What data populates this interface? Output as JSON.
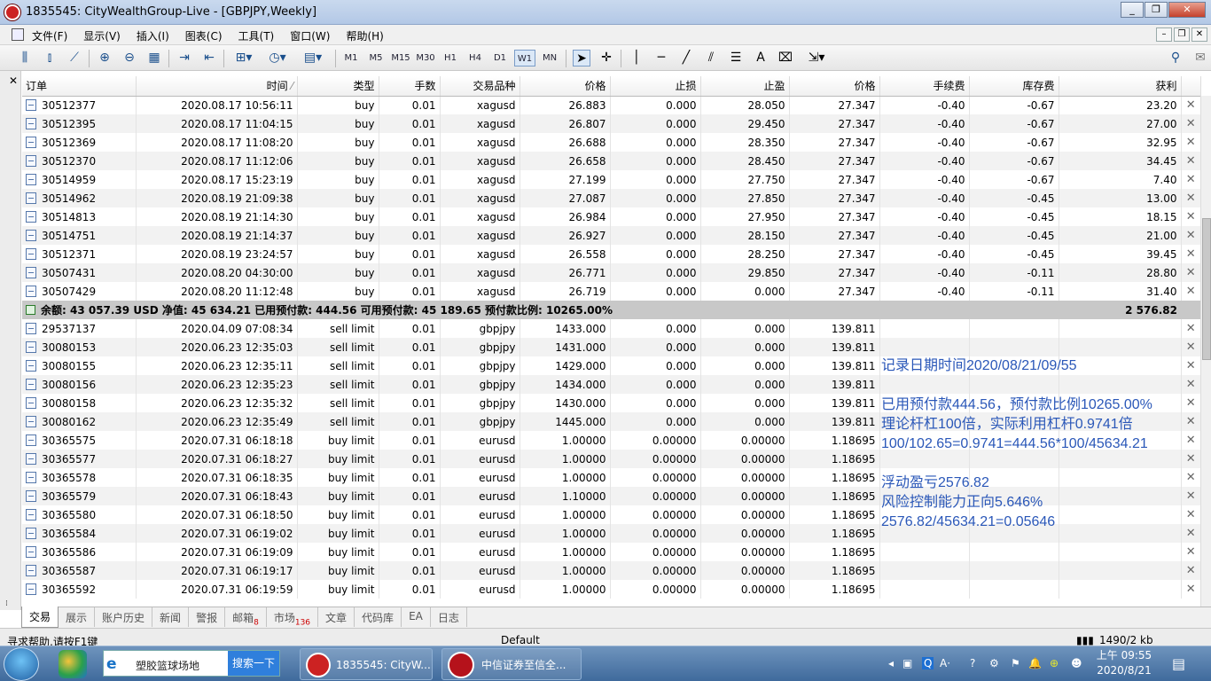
{
  "window": {
    "title": "1835545: CityWealthGroup-Live - [GBPJPY,Weekly]"
  },
  "menu": [
    "文件(F)",
    "显示(V)",
    "插入(I)",
    "图表(C)",
    "工具(T)",
    "窗口(W)",
    "帮助(H)"
  ],
  "toolbar": {
    "timeframes": [
      "M1",
      "M5",
      "M15",
      "M30",
      "H1",
      "H4",
      "D1",
      "W1",
      "MN"
    ],
    "active_timeframe": "W1",
    "text_tool": "A"
  },
  "columns": [
    "订单",
    "时间",
    "类型",
    "手数",
    "交易品种",
    "价格",
    "止损",
    "止盈",
    "价格",
    "手续费",
    "库存费",
    "获利"
  ],
  "open_orders": [
    [
      "30512377",
      "2020.08.17 10:56:11",
      "buy",
      "0.01",
      "xagusd",
      "26.883",
      "0.000",
      "28.050",
      "27.347",
      "-0.40",
      "-0.67",
      "23.20"
    ],
    [
      "30512395",
      "2020.08.17 11:04:15",
      "buy",
      "0.01",
      "xagusd",
      "26.807",
      "0.000",
      "29.450",
      "27.347",
      "-0.40",
      "-0.67",
      "27.00"
    ],
    [
      "30512369",
      "2020.08.17 11:08:20",
      "buy",
      "0.01",
      "xagusd",
      "26.688",
      "0.000",
      "28.350",
      "27.347",
      "-0.40",
      "-0.67",
      "32.95"
    ],
    [
      "30512370",
      "2020.08.17 11:12:06",
      "buy",
      "0.01",
      "xagusd",
      "26.658",
      "0.000",
      "28.450",
      "27.347",
      "-0.40",
      "-0.67",
      "34.45"
    ],
    [
      "30514959",
      "2020.08.17 15:23:19",
      "buy",
      "0.01",
      "xagusd",
      "27.199",
      "0.000",
      "27.750",
      "27.347",
      "-0.40",
      "-0.67",
      "7.40"
    ],
    [
      "30514962",
      "2020.08.19 21:09:38",
      "buy",
      "0.01",
      "xagusd",
      "27.087",
      "0.000",
      "27.850",
      "27.347",
      "-0.40",
      "-0.45",
      "13.00"
    ],
    [
      "30514813",
      "2020.08.19 21:14:30",
      "buy",
      "0.01",
      "xagusd",
      "26.984",
      "0.000",
      "27.950",
      "27.347",
      "-0.40",
      "-0.45",
      "18.15"
    ],
    [
      "30514751",
      "2020.08.19 21:14:37",
      "buy",
      "0.01",
      "xagusd",
      "26.927",
      "0.000",
      "28.150",
      "27.347",
      "-0.40",
      "-0.45",
      "21.00"
    ],
    [
      "30512371",
      "2020.08.19 23:24:57",
      "buy",
      "0.01",
      "xagusd",
      "26.558",
      "0.000",
      "28.250",
      "27.347",
      "-0.40",
      "-0.45",
      "39.45"
    ],
    [
      "30507431",
      "2020.08.20 04:30:00",
      "buy",
      "0.01",
      "xagusd",
      "26.771",
      "0.000",
      "29.850",
      "27.347",
      "-0.40",
      "-0.11",
      "28.80"
    ],
    [
      "30507429",
      "2020.08.20 11:12:48",
      "buy",
      "0.01",
      "xagusd",
      "26.719",
      "0.000",
      "0.000",
      "27.347",
      "-0.40",
      "-0.11",
      "31.40"
    ]
  ],
  "summary": {
    "text": "余额: 43 057.39 USD  净值: 45 634.21  已用预付款: 444.56  可用预付款: 45 189.65  预付款比例: 10265.00%",
    "profit": "2 576.82"
  },
  "pending_orders": [
    [
      "29537137",
      "2020.04.09 07:08:34",
      "sell limit",
      "0.01",
      "gbpjpy",
      "1433.000",
      "0.000",
      "0.000",
      "139.811"
    ],
    [
      "30080153",
      "2020.06.23 12:35:03",
      "sell limit",
      "0.01",
      "gbpjpy",
      "1431.000",
      "0.000",
      "0.000",
      "139.811"
    ],
    [
      "30080155",
      "2020.06.23 12:35:11",
      "sell limit",
      "0.01",
      "gbpjpy",
      "1429.000",
      "0.000",
      "0.000",
      "139.811"
    ],
    [
      "30080156",
      "2020.06.23 12:35:23",
      "sell limit",
      "0.01",
      "gbpjpy",
      "1434.000",
      "0.000",
      "0.000",
      "139.811"
    ],
    [
      "30080158",
      "2020.06.23 12:35:32",
      "sell limit",
      "0.01",
      "gbpjpy",
      "1430.000",
      "0.000",
      "0.000",
      "139.811"
    ],
    [
      "30080162",
      "2020.06.23 12:35:49",
      "sell limit",
      "0.01",
      "gbpjpy",
      "1445.000",
      "0.000",
      "0.000",
      "139.811"
    ],
    [
      "30365575",
      "2020.07.31 06:18:18",
      "buy limit",
      "0.01",
      "eurusd",
      "1.00000",
      "0.00000",
      "0.00000",
      "1.18695"
    ],
    [
      "30365577",
      "2020.07.31 06:18:27",
      "buy limit",
      "0.01",
      "eurusd",
      "1.00000",
      "0.00000",
      "0.00000",
      "1.18695"
    ],
    [
      "30365578",
      "2020.07.31 06:18:35",
      "buy limit",
      "0.01",
      "eurusd",
      "1.00000",
      "0.00000",
      "0.00000",
      "1.18695"
    ],
    [
      "30365579",
      "2020.07.31 06:18:43",
      "buy limit",
      "0.01",
      "eurusd",
      "1.10000",
      "0.00000",
      "0.00000",
      "1.18695"
    ],
    [
      "30365580",
      "2020.07.31 06:18:50",
      "buy limit",
      "0.01",
      "eurusd",
      "1.00000",
      "0.00000",
      "0.00000",
      "1.18695"
    ],
    [
      "30365584",
      "2020.07.31 06:19:02",
      "buy limit",
      "0.01",
      "eurusd",
      "1.00000",
      "0.00000",
      "0.00000",
      "1.18695"
    ],
    [
      "30365586",
      "2020.07.31 06:19:09",
      "buy limit",
      "0.01",
      "eurusd",
      "1.00000",
      "0.00000",
      "0.00000",
      "1.18695"
    ],
    [
      "30365587",
      "2020.07.31 06:19:17",
      "buy limit",
      "0.01",
      "eurusd",
      "1.00000",
      "0.00000",
      "0.00000",
      "1.18695"
    ],
    [
      "30365592",
      "2020.07.31 06:19:59",
      "buy limit",
      "0.01",
      "eurusd",
      "1.00000",
      "0.00000",
      "0.00000",
      "1.18695"
    ]
  ],
  "annotations": [
    "记录日期时间2020/08/21/09/55",
    "",
    "已用预付款444.56，预付款比例10265.00%",
    "理论杆杠100倍，实际利用杠杆0.9741倍",
    "100/102.65=0.9741=444.56*100/45634.21",
    "",
    "浮动盈亏2576.82",
    "风险控制能力正向5.646%",
    "2576.82/45634.21=0.05646"
  ],
  "tabs": [
    {
      "label": "交易",
      "badge": ""
    },
    {
      "label": "展示",
      "badge": ""
    },
    {
      "label": "账户历史",
      "badge": ""
    },
    {
      "label": "新闻",
      "badge": ""
    },
    {
      "label": "警报",
      "badge": ""
    },
    {
      "label": "邮箱",
      "badge": "8"
    },
    {
      "label": "市场",
      "badge": "136"
    },
    {
      "label": "文章",
      "badge": ""
    },
    {
      "label": "代码库",
      "badge": ""
    },
    {
      "label": "EA",
      "badge": ""
    },
    {
      "label": "日志",
      "badge": ""
    }
  ],
  "active_tab": "交易",
  "status": {
    "help": "寻求帮助,请按F1键",
    "profile": "Default",
    "traffic": "1490/2 kb"
  },
  "taskbar": {
    "search_text": "塑胶篮球场地",
    "search_button": "搜索一下",
    "items": [
      "1835545: CityW...",
      "中信证券至信全..."
    ],
    "clock_time": "上午 09:55",
    "clock_date": "2020/8/21"
  },
  "colors": {
    "annotation": "#2a57b8",
    "title_bg": "#c9d9ee",
    "summary_bg": "#c8c8c8",
    "taskbar": "#3f6a9c"
  }
}
